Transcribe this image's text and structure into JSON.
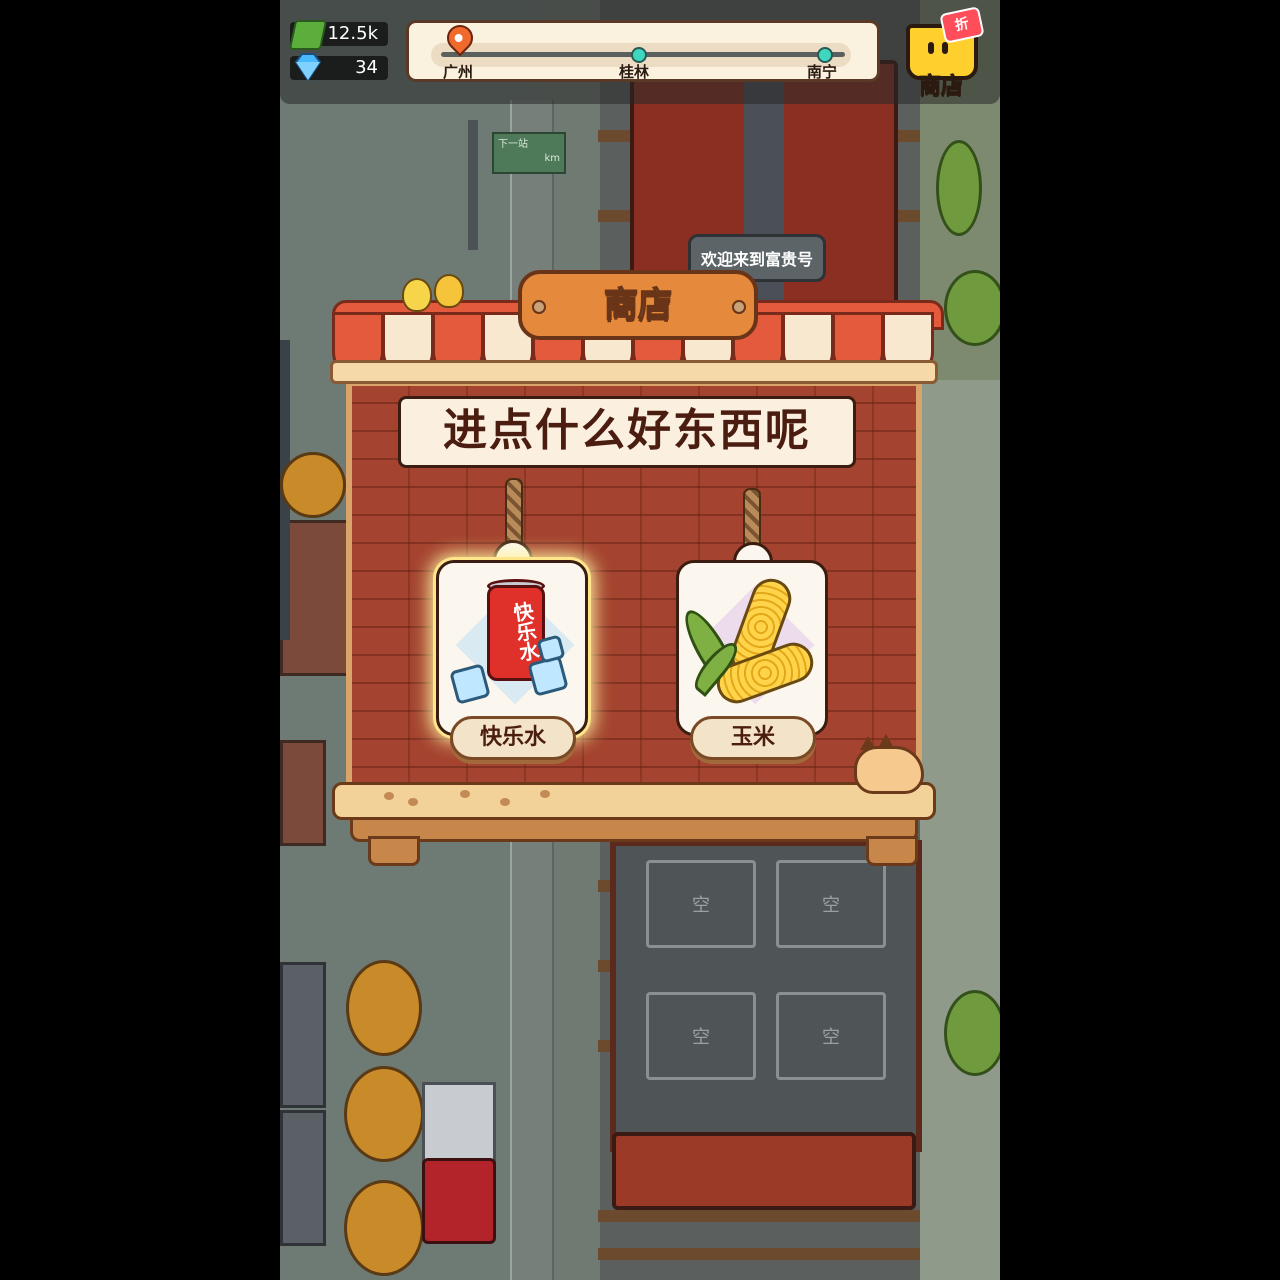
{
  "hud": {
    "cash": "12.5k",
    "gems": "34",
    "cash_icon": "cash-stack-icon",
    "gem_icon": "diamond-icon"
  },
  "route": {
    "cities": [
      "广州",
      "桂林",
      "南宁"
    ],
    "current_city_index": 0,
    "pin_icon": "location-pin-icon"
  },
  "shop_button": {
    "label": "商店",
    "badge": "折",
    "icon": "shopping-cart-icon"
  },
  "scenery": {
    "station_sign_line1": "下一站",
    "station_sign_line2": "km",
    "slot_label": "空",
    "welcome_bubble": "欢迎来到富贵号"
  },
  "shop": {
    "sign_title": "商店",
    "headline": "进点什么好东西呢",
    "items": [
      {
        "name": "快乐水",
        "can_text": "快乐水",
        "icon": "soda-can-icon",
        "selected": true
      },
      {
        "name": "玉米",
        "icon": "corn-icon",
        "selected": false
      }
    ]
  },
  "colors": {
    "panel_brick": "#a4432f",
    "awning_red": "#e45a3d",
    "accent_teal": "#3fd6c0",
    "text_dark": "#4a1d10"
  }
}
